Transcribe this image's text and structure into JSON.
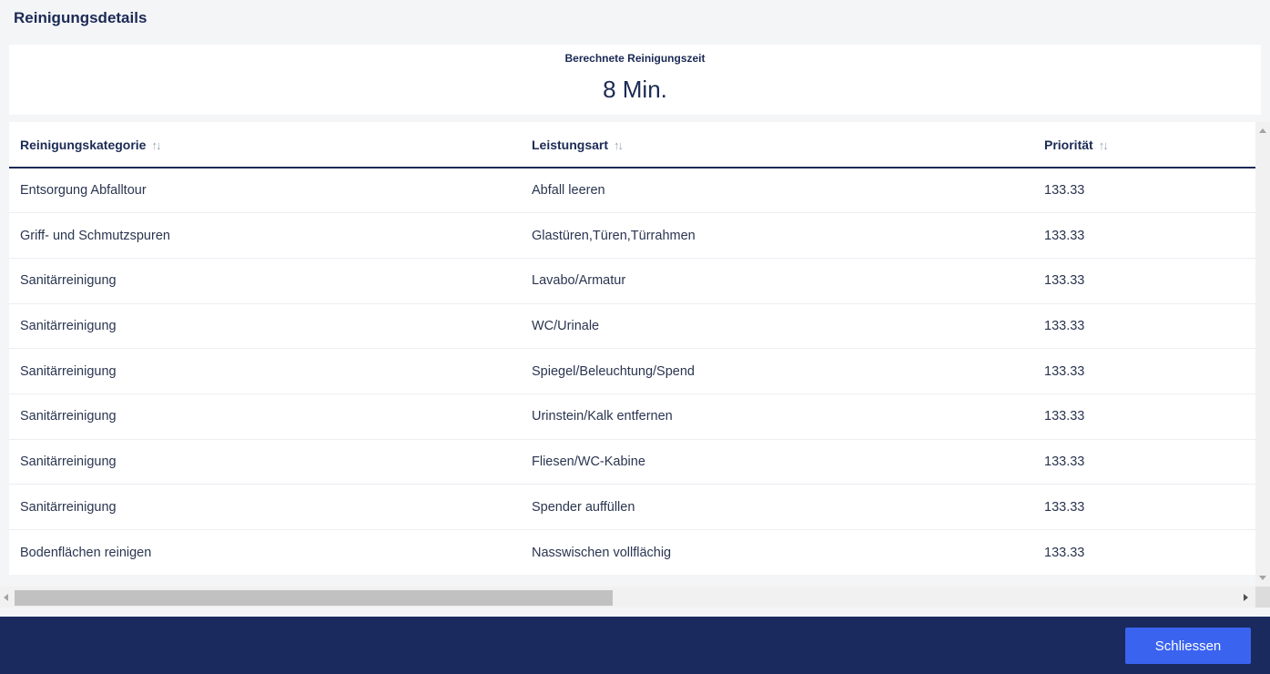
{
  "dialog": {
    "title": "Reinigungsdetails"
  },
  "summary": {
    "label": "Berechnete Reinigungszeit",
    "value": "8 Min."
  },
  "table": {
    "columns": [
      {
        "label": "Reinigungskategorie",
        "sort_icon": "↑↓"
      },
      {
        "label": "Leistungsart",
        "sort_icon": "↑↓"
      },
      {
        "label": "Priorität",
        "sort_icon": "↑↓"
      }
    ],
    "rows": [
      {
        "kategorie": "Entsorgung Abfalltour",
        "leistungsart": "Abfall leeren",
        "prioritaet": "133.33"
      },
      {
        "kategorie": "Griff- und Schmutzspuren",
        "leistungsart": "Glastüren,Türen,Türrahmen",
        "prioritaet": "133.33"
      },
      {
        "kategorie": "Sanitärreinigung",
        "leistungsart": "Lavabo/Armatur",
        "prioritaet": "133.33"
      },
      {
        "kategorie": "Sanitärreinigung",
        "leistungsart": "WC/Urinale",
        "prioritaet": "133.33"
      },
      {
        "kategorie": "Sanitärreinigung",
        "leistungsart": "Spiegel/Beleuchtung/Spend",
        "prioritaet": "133.33"
      },
      {
        "kategorie": "Sanitärreinigung",
        "leistungsart": "Urinstein/Kalk entfernen",
        "prioritaet": "133.33"
      },
      {
        "kategorie": "Sanitärreinigung",
        "leistungsart": "Fliesen/WC-Kabine",
        "prioritaet": "133.33"
      },
      {
        "kategorie": "Sanitärreinigung",
        "leistungsart": "Spender auffüllen",
        "prioritaet": "133.33"
      },
      {
        "kategorie": "Bodenflächen reinigen",
        "leistungsart": "Nasswischen vollflächig",
        "prioritaet": "133.33"
      }
    ]
  },
  "footer": {
    "close_label": "Schliessen"
  },
  "colors": {
    "header_text": "#1b2a55",
    "footer_bg": "#1b2a5e",
    "button_bg": "#3a63f0"
  }
}
